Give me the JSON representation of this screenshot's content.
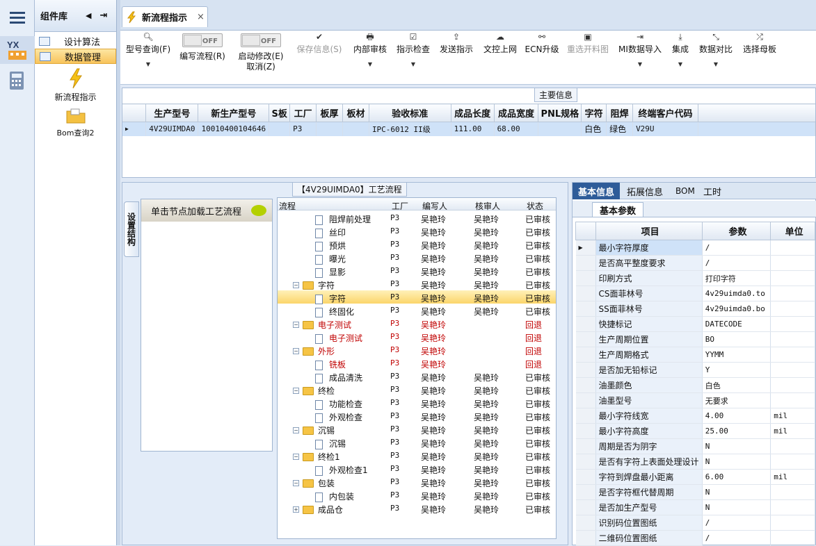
{
  "sidebar": {
    "title": "组件库",
    "items": [
      {
        "label": "设计算法"
      },
      {
        "label": "数据管理"
      }
    ],
    "tiles": [
      {
        "label": "新流程指示"
      },
      {
        "label": "Bom查询2"
      }
    ]
  },
  "tab": {
    "title": "新流程指示"
  },
  "toolbar": {
    "model_query": "型号查询(F)",
    "edit_flow": "编写流程(R)",
    "start_modify": "启动修改(E)",
    "cancel": "取消(Z)",
    "toggle_off": "OFF",
    "save_info": "保存信息(S)",
    "internal_audit": "内部审核",
    "indication_check": "指示检查",
    "send_indication": "发送指示",
    "upload": "文控上网",
    "ecn": "ECN升级",
    "reselect": "重选开料图",
    "mi_import": "MI数据导入",
    "integrate": "集成",
    "data_compare": "数据对比",
    "select_master": "选择母板"
  },
  "main_info": {
    "legend": "主要信息",
    "headers": [
      "生产型号",
      "新生产型号",
      "S板",
      "工厂",
      "板厚",
      "板材",
      "验收标准",
      "成品长度",
      "成品宽度",
      "PNL规格",
      "字符",
      "阻焊",
      "终端客户代码"
    ],
    "row": [
      "4V29UIMDA0",
      "10010400104646",
      "",
      "P3",
      "",
      "",
      "IPC-6012 II级",
      "111.00",
      "68.00",
      "",
      "白色",
      "绿色",
      "V29U"
    ]
  },
  "process": {
    "legend": "【4V29UIMDA0】工艺流程",
    "side_tab": "设置结构",
    "hint": "单击节点加载工艺流程",
    "headers": [
      "流程",
      "工厂",
      "编写人",
      "核审人",
      "状态"
    ],
    "rows": [
      {
        "name": "阻焊前处理",
        "level": 2,
        "type": "doc",
        "factory": "P3",
        "writer": "吴艳玲",
        "reviewer": "吴艳玲",
        "status": "已审核",
        "red": false
      },
      {
        "name": "丝印",
        "level": 2,
        "type": "doc",
        "factory": "P3",
        "writer": "吴艳玲",
        "reviewer": "吴艳玲",
        "status": "已审核",
        "red": false
      },
      {
        "name": "预烘",
        "level": 2,
        "type": "doc",
        "factory": "P3",
        "writer": "吴艳玲",
        "reviewer": "吴艳玲",
        "status": "已审核",
        "red": false
      },
      {
        "name": "曝光",
        "level": 2,
        "type": "doc",
        "factory": "P3",
        "writer": "吴艳玲",
        "reviewer": "吴艳玲",
        "status": "已审核",
        "red": false
      },
      {
        "name": "显影",
        "level": 2,
        "type": "doc",
        "factory": "P3",
        "writer": "吴艳玲",
        "reviewer": "吴艳玲",
        "status": "已审核",
        "red": false
      },
      {
        "name": "字符",
        "level": 1,
        "type": "folder",
        "factory": "P3",
        "writer": "吴艳玲",
        "reviewer": "吴艳玲",
        "status": "已审核",
        "red": false
      },
      {
        "name": "字符",
        "level": 2,
        "type": "doc",
        "factory": "P3",
        "writer": "吴艳玲",
        "reviewer": "吴艳玲",
        "status": "已审核",
        "red": false,
        "selected": true
      },
      {
        "name": "终固化",
        "level": 2,
        "type": "doc",
        "factory": "P3",
        "writer": "吴艳玲",
        "reviewer": "吴艳玲",
        "status": "已审核",
        "red": false
      },
      {
        "name": "电子测试",
        "level": 1,
        "type": "folder",
        "factory": "P3",
        "writer": "吴艳玲",
        "reviewer": "",
        "status": "回退",
        "red": true
      },
      {
        "name": "电子测试",
        "level": 2,
        "type": "doc",
        "factory": "P3",
        "writer": "吴艳玲",
        "reviewer": "",
        "status": "回退",
        "red": true
      },
      {
        "name": "外形",
        "level": 1,
        "type": "folder",
        "factory": "P3",
        "writer": "吴艳玲",
        "reviewer": "",
        "status": "回退",
        "red": true
      },
      {
        "name": "铣板",
        "level": 2,
        "type": "doc",
        "factory": "P3",
        "writer": "吴艳玲",
        "reviewer": "",
        "status": "回退",
        "red": true
      },
      {
        "name": "成品清洗",
        "level": 2,
        "type": "doc",
        "factory": "P3",
        "writer": "吴艳玲",
        "reviewer": "吴艳玲",
        "status": "已审核",
        "red": false
      },
      {
        "name": "终检",
        "level": 1,
        "type": "folder",
        "factory": "P3",
        "writer": "吴艳玲",
        "reviewer": "吴艳玲",
        "status": "已审核",
        "red": false
      },
      {
        "name": "功能检查",
        "level": 2,
        "type": "doc",
        "factory": "P3",
        "writer": "吴艳玲",
        "reviewer": "吴艳玲",
        "status": "已审核",
        "red": false
      },
      {
        "name": "外观检查",
        "level": 2,
        "type": "doc",
        "factory": "P3",
        "writer": "吴艳玲",
        "reviewer": "吴艳玲",
        "status": "已审核",
        "red": false
      },
      {
        "name": "沉锡",
        "level": 1,
        "type": "folder",
        "factory": "P3",
        "writer": "吴艳玲",
        "reviewer": "吴艳玲",
        "status": "已审核",
        "red": false
      },
      {
        "name": "沉锡",
        "level": 2,
        "type": "doc",
        "factory": "P3",
        "writer": "吴艳玲",
        "reviewer": "吴艳玲",
        "status": "已审核",
        "red": false
      },
      {
        "name": "终检1",
        "level": 1,
        "type": "folder",
        "factory": "P3",
        "writer": "吴艳玲",
        "reviewer": "吴艳玲",
        "status": "已审核",
        "red": false
      },
      {
        "name": "外观检查1",
        "level": 2,
        "type": "doc",
        "factory": "P3",
        "writer": "吴艳玲",
        "reviewer": "吴艳玲",
        "status": "已审核",
        "red": false
      },
      {
        "name": "包装",
        "level": 1,
        "type": "folder",
        "factory": "P3",
        "writer": "吴艳玲",
        "reviewer": "吴艳玲",
        "status": "已审核",
        "red": false
      },
      {
        "name": "内包装",
        "level": 2,
        "type": "doc",
        "factory": "P3",
        "writer": "吴艳玲",
        "reviewer": "吴艳玲",
        "status": "已审核",
        "red": false
      },
      {
        "name": "成品仓",
        "level": 1,
        "type": "folder-collapsed",
        "factory": "P3",
        "writer": "吴艳玲",
        "reviewer": "吴艳玲",
        "status": "已审核",
        "red": false
      }
    ]
  },
  "info": {
    "tabs": [
      "基本信息",
      "拓展信息",
      "BOM",
      "工时"
    ],
    "subtab": "基本参数",
    "headers": [
      "项目",
      "参数",
      "单位"
    ],
    "rows": [
      [
        "最小字符厚度",
        "/",
        ""
      ],
      [
        "是否高平整度要求",
        "/",
        ""
      ],
      [
        "印刷方式",
        "打印字符",
        ""
      ],
      [
        "CS面菲林号",
        "4v29uimda0.to",
        ""
      ],
      [
        "SS面菲林号",
        "4v29uimda0.bo",
        ""
      ],
      [
        "快捷标记",
        "DATECODE",
        ""
      ],
      [
        "生产周期位置",
        "BO",
        ""
      ],
      [
        "生产周期格式",
        "YYMM",
        ""
      ],
      [
        "是否加无铅标记",
        "Y",
        ""
      ],
      [
        "油墨颜色",
        "白色",
        ""
      ],
      [
        "油墨型号",
        "无要求",
        ""
      ],
      [
        "最小字符线宽",
        "4.00",
        "mil"
      ],
      [
        "最小字符高度",
        "25.00",
        "mil"
      ],
      [
        "周期是否为阴字",
        "N",
        ""
      ],
      [
        "是否有字符上表面处理设计",
        "N",
        ""
      ],
      [
        "字符到焊盘最小距离",
        "6.00",
        "mil"
      ],
      [
        "是否字符框代替周期",
        "N",
        ""
      ],
      [
        "是否加生产型号",
        "N",
        ""
      ],
      [
        "识别码位置图纸",
        "/",
        ""
      ],
      [
        "二维码位置图纸",
        "/",
        ""
      ]
    ]
  }
}
